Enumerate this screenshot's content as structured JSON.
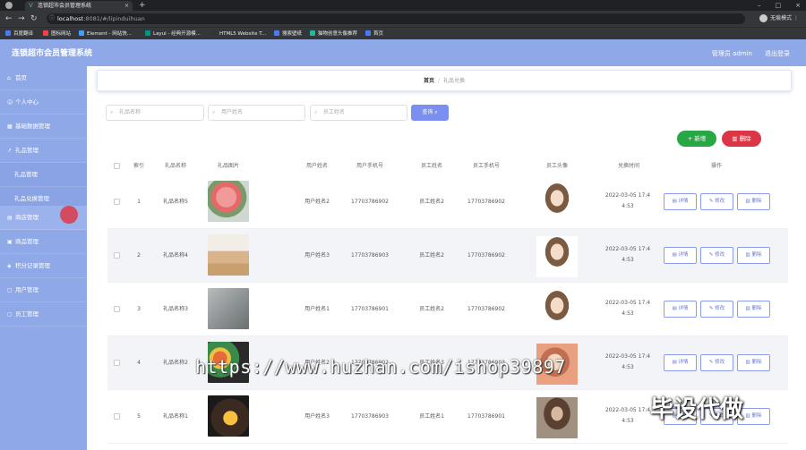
{
  "browser": {
    "tab_title": "连锁超市会员管理系统",
    "url_host": "localhost",
    "url_rest": ":8081/#/lipinduihuan",
    "profile_label": "无痕模式",
    "bookmarks": [
      "百度翻译",
      "图标网站",
      "Element - 网站快...",
      "Layui - 经典开源模...",
      "HTML5 Website T...",
      "搜索壁纸",
      "猫物创意头像推荐",
      "首页"
    ]
  },
  "header": {
    "title": "连锁超市会员管理系统",
    "user": "管理员 admin",
    "logout": "退出登录"
  },
  "sidebar": {
    "items": [
      {
        "label": "首页",
        "icon": "home-icon"
      },
      {
        "label": "个人中心",
        "icon": "user-icon"
      },
      {
        "label": "基础数据管理",
        "icon": "grid-icon"
      },
      {
        "label": "礼品管理",
        "icon": "chart-icon"
      },
      {
        "label": "礼品管理",
        "icon": ""
      },
      {
        "label": "礼品兑换管理",
        "icon": ""
      },
      {
        "label": "商店管理",
        "icon": "shop-icon"
      },
      {
        "label": "商品管理",
        "icon": "goods-icon"
      },
      {
        "label": "积分记录管理",
        "icon": "record-icon"
      },
      {
        "label": "用户管理",
        "icon": "users-icon"
      },
      {
        "label": "员工管理",
        "icon": "staff-icon"
      }
    ]
  },
  "breadcrumb": {
    "home": "首页",
    "sep": "/",
    "current": "礼品兑换"
  },
  "search": {
    "gift_name_placeholder": "礼品名称",
    "user_name_placeholder": "用户姓名",
    "staff_name_placeholder": "员工姓名",
    "search_label": "查询"
  },
  "toolbar": {
    "add_label": "+ 新增",
    "delete_label": "删除"
  },
  "table": {
    "headers": [
      "索引",
      "礼品名称",
      "礼品图片",
      "用户姓名",
      "用户手机号",
      "员工姓名",
      "员工手机号",
      "员工头像",
      "兑换时间",
      "操作"
    ],
    "rows": [
      {
        "index": "1",
        "gift": "礼品名称5",
        "user": "用户姓名2",
        "user_phone": "17703786902",
        "staff": "员工姓名2",
        "staff_phone": "17703786902",
        "time1": "2022-03-05 17:4",
        "time2": "4:53"
      },
      {
        "index": "2",
        "gift": "礼品名称4",
        "user": "用户姓名3",
        "user_phone": "17703786903",
        "staff": "员工姓名2",
        "staff_phone": "17703786902",
        "time1": "2022-03-05 17:4",
        "time2": "4:53"
      },
      {
        "index": "3",
        "gift": "礼品名称3",
        "user": "用户姓名1",
        "user_phone": "17703786901",
        "staff": "员工姓名2",
        "staff_phone": "17703786902",
        "time1": "2022-03-05 17:4",
        "time2": "4:53"
      },
      {
        "index": "4",
        "gift": "礼品名称2",
        "user": "用户姓名2",
        "user_phone": "17703786902",
        "staff": "员工姓名3",
        "staff_phone": "17703786903",
        "time1": "2022-03-05 17:4",
        "time2": "4:53"
      },
      {
        "index": "5",
        "gift": "礼品名称1",
        "user": "用户姓名3",
        "user_phone": "17703786903",
        "staff": "员工姓名1",
        "staff_phone": "17703786901",
        "time1": "2022-03-05 17:4",
        "time2": "4:53"
      }
    ],
    "actions": {
      "detail": "详情",
      "edit": "修改",
      "delete": "删除"
    }
  },
  "watermark": {
    "url": "https://www.huzhan.com/ishop39897",
    "brand": "毕设代做"
  },
  "colors": {
    "header_bg": "#8ea8e8",
    "primary": "#7b8ff0",
    "add": "#28a745",
    "delete": "#dc3545"
  }
}
